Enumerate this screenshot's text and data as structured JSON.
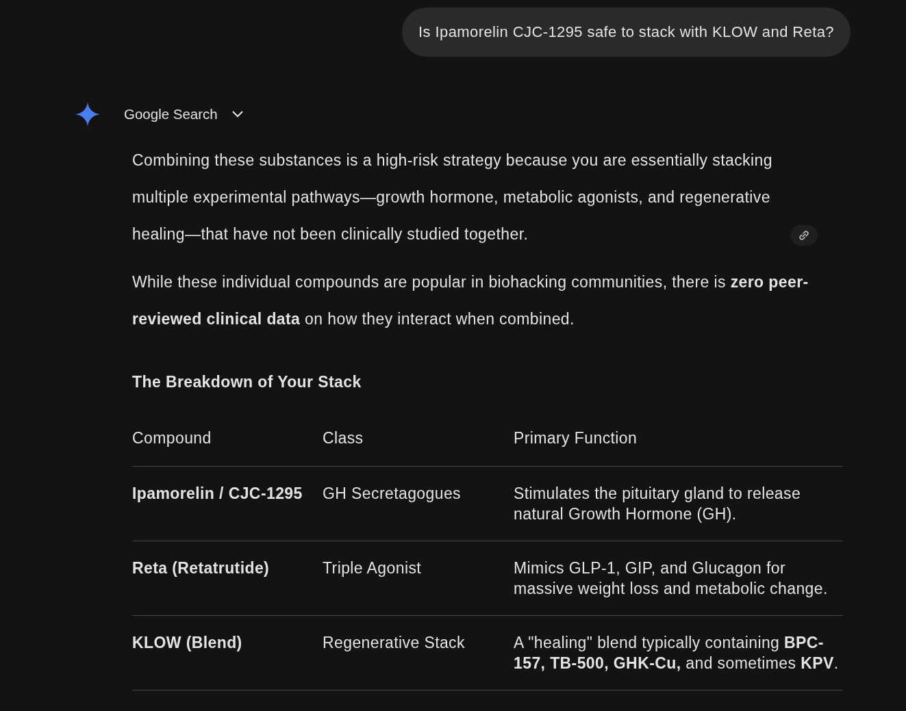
{
  "user_message": {
    "text": "Is Ipamorelin CJC-1295 safe to stack with KLOW and Reta?"
  },
  "response": {
    "source": {
      "label": "Google Search",
      "expanded": false
    },
    "paragraphs": [
      {
        "text": "Combining these substances is a high-risk strategy because you are essentially stacking multiple experimental pathways—growth hormone, metabolic agonists, and regenerative healing—that have not been clinically studied together.",
        "link": true
      },
      {
        "text": "While these individual compounds are popular in biohacking communities, there is **zero peer-reviewed clinical data** on how they interact when combined.",
        "link": false
      }
    ],
    "heading": "The Breakdown of Your Stack",
    "table": {
      "columns": [
        "Compound",
        "Class",
        "Primary Function"
      ],
      "rows": [
        [
          "Ipamorelin / CJC-1295",
          "GH Secretagogues",
          "Stimulates the pituitary gland to release natural Growth Hormone (GH)."
        ],
        [
          "Reta (Retatrutide)",
          "Triple Agonist",
          "Mimics GLP-1, GIP, and Glucagon for massive weight loss and metabolic change."
        ],
        [
          "KLOW (Blend)",
          "Regenerative Stack",
          "A \"healing\" blend typically containing **BPC-157, TB-500, GHK-Cu,** and sometimes **KPV**."
        ]
      ]
    }
  }
}
